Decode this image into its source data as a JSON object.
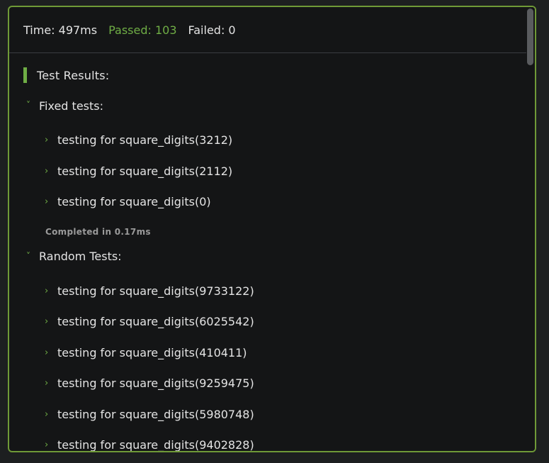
{
  "stats": {
    "time": "Time: 497ms",
    "passed": "Passed: 103",
    "failed": "Failed: 0"
  },
  "results": {
    "heading": "Test Results:",
    "groups": [
      {
        "title": "Fixed tests:",
        "items": [
          "testing for square_digits(3212)",
          "testing for square_digits(2112)",
          "testing for square_digits(0)"
        ],
        "completed": "Completed in 0.17ms"
      },
      {
        "title": "Random Tests:",
        "items": [
          "testing for square_digits(9733122)",
          "testing for square_digits(6025542)",
          "testing for square_digits(410411)",
          "testing for square_digits(9259475)",
          "testing for square_digits(5980748)",
          "testing for square_digits(9402828)"
        ]
      }
    ]
  },
  "colors": {
    "accent": "#6fad45",
    "border": "#6f9a37",
    "background": "#141516",
    "text": "#e4e4e4"
  },
  "icons": {
    "group_toggle": "chevron-down-icon",
    "item_toggle": "chevron-right-icon"
  }
}
